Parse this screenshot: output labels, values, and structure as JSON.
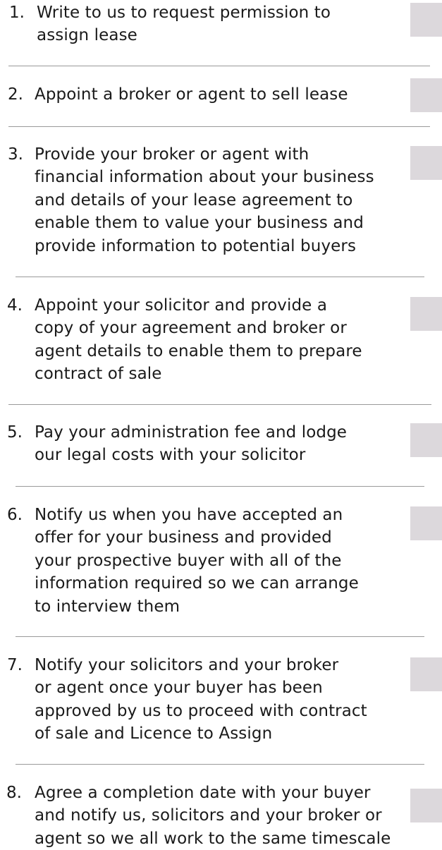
{
  "checklist": {
    "colors": {
      "checkbox": "#dcd8dc",
      "divider": "#9a9a9a",
      "text": "#1a1a1a"
    },
    "steps": [
      {
        "number": "1.",
        "text": "Write to us to request permission to\nassign lease"
      },
      {
        "number": "2.",
        "text": "Appoint a broker or agent to sell lease"
      },
      {
        "number": "3.",
        "text": "Provide your broker or agent with\nfinancial information about your business\nand details of your lease agreement to\nenable them to value your business and\nprovide information to potential buyers"
      },
      {
        "number": "4.",
        "text": "Appoint your solicitor and provide a\ncopy of your agreement and broker or\nagent details to enable them to prepare\ncontract of sale"
      },
      {
        "number": "5.",
        "text": "Pay your administration fee and lodge\nour legal costs with your solicitor"
      },
      {
        "number": "6.",
        "text": "Notify us when you have accepted an\noffer for your business and provided\nyour prospective buyer with all of the\ninformation required so we can arrange\nto interview them"
      },
      {
        "number": "7.",
        "text": "Notify your solicitors and your broker\nor agent once your buyer has been\napproved by us to proceed with contract\nof sale and Licence to Assign"
      },
      {
        "number": "8.",
        "text": "Agree a completion date with your buyer\nand notify us, solicitors and your broker or\nagent so we all work to the same timescale"
      }
    ]
  }
}
